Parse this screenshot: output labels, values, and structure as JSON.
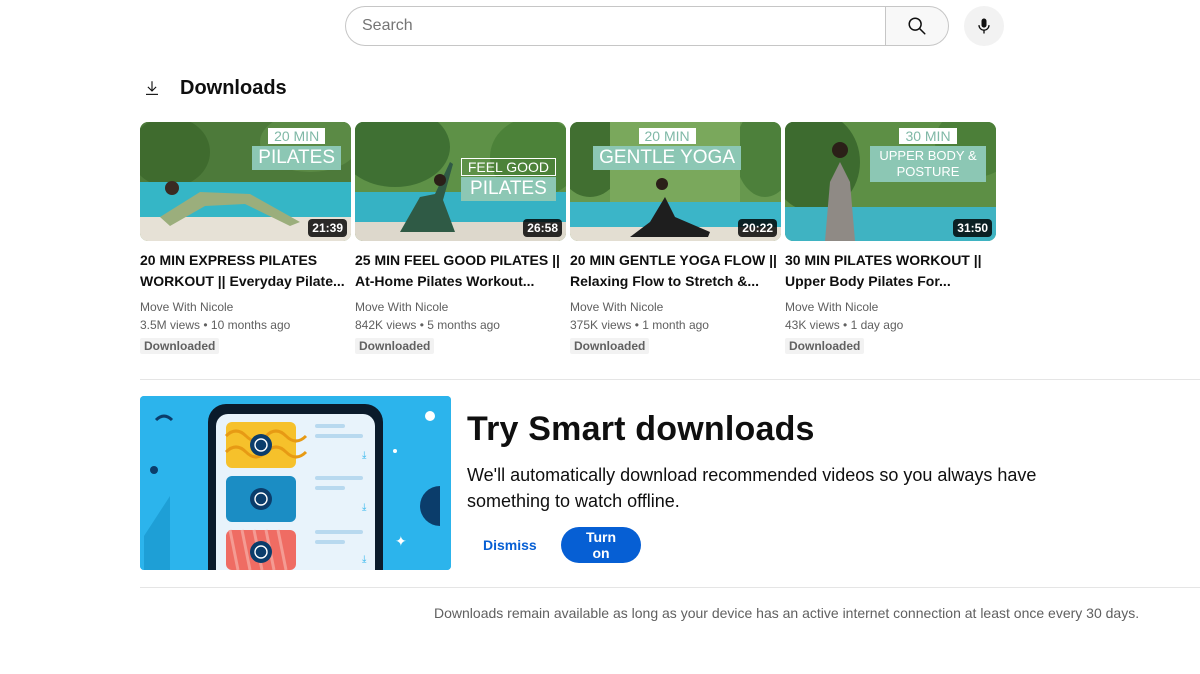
{
  "search": {
    "placeholder": "Search"
  },
  "icons": {
    "search": "search-icon",
    "mic": "mic-icon",
    "download": "download-icon"
  },
  "downloads": {
    "title": "Downloads",
    "videos": [
      {
        "title": "20 MIN EXPRESS PILATES WORKOUT || Everyday Pilate...",
        "channel": "Move With Nicole",
        "views": "3.5M views",
        "age": "10 months ago",
        "duration": "21:39",
        "badge": "Downloaded",
        "overlay_top": "20 MIN",
        "overlay_main": "PILATES"
      },
      {
        "title": "25 MIN FEEL GOOD PILATES || At-Home Pilates Workout...",
        "channel": "Move With Nicole",
        "views": "842K views",
        "age": "5 months ago",
        "duration": "26:58",
        "badge": "Downloaded",
        "overlay_top": "FEEL GOOD",
        "overlay_main": "PILATES"
      },
      {
        "title": "20 MIN GENTLE YOGA FLOW || Relaxing Flow to Stretch &...",
        "channel": "Move With Nicole",
        "views": "375K views",
        "age": "1 month ago",
        "duration": "20:22",
        "badge": "Downloaded",
        "overlay_top": "20 MIN",
        "overlay_main": "GENTLE YOGA"
      },
      {
        "title": "30 MIN PILATES WORKOUT || Upper Body Pilates For...",
        "channel": "Move With Nicole",
        "views": "43K views",
        "age": "1 day ago",
        "duration": "31:50",
        "badge": "Downloaded",
        "overlay_top": "30 MIN",
        "overlay_main": "UPPER BODY & POSTURE"
      }
    ]
  },
  "smart_downloads": {
    "title": "Try Smart downloads",
    "description": "We'll automatically download recommended videos so you always have something to watch offline.",
    "dismiss_label": "Dismiss",
    "turn_on_label": "Turn on"
  },
  "footnote": "Downloads remain available as long as your device has an active internet connection at least once every 30 days.",
  "colors": {
    "accent": "#065fd4",
    "promo_bg": "#2cb4ec"
  }
}
